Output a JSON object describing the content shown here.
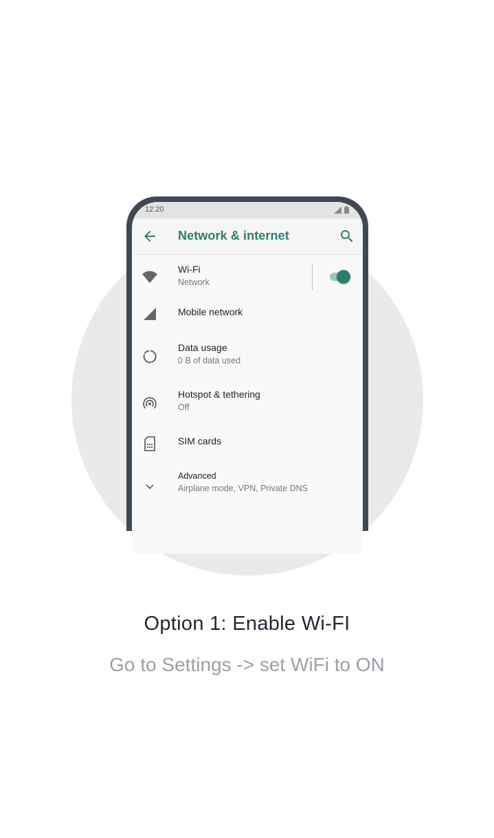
{
  "status_bar": {
    "time": "12:20"
  },
  "app_bar": {
    "title": "Network & internet",
    "back_icon": "arrow-back-icon",
    "search_icon": "search-icon"
  },
  "settings": [
    {
      "title": "Wi-Fi",
      "subtitle": "Network",
      "icon": "wifi-icon",
      "toggle_on": true
    },
    {
      "title": "Mobile network",
      "subtitle": "",
      "icon": "signal-icon"
    },
    {
      "title": "Data usage",
      "subtitle": "0 B of data used",
      "icon": "data-usage-icon"
    },
    {
      "title": "Hotspot & tethering",
      "subtitle": "Off",
      "icon": "hotspot-icon"
    },
    {
      "title": "SIM cards",
      "subtitle": "",
      "icon": "sim-card-icon"
    },
    {
      "title": "Advanced",
      "subtitle": "Airplane mode, VPN, Private DNS",
      "icon": "chevron-down-icon"
    }
  ],
  "caption": {
    "title": "Option 1: Enable Wi-FI",
    "subtitle": "Go to Settings -> set WiFi to ON"
  },
  "colors": {
    "accent": "#2e7d6e",
    "frame": "#3f4854",
    "circle": "#eaeaea",
    "caption_title": "#1e2633",
    "caption_sub": "#9aa0a6"
  }
}
